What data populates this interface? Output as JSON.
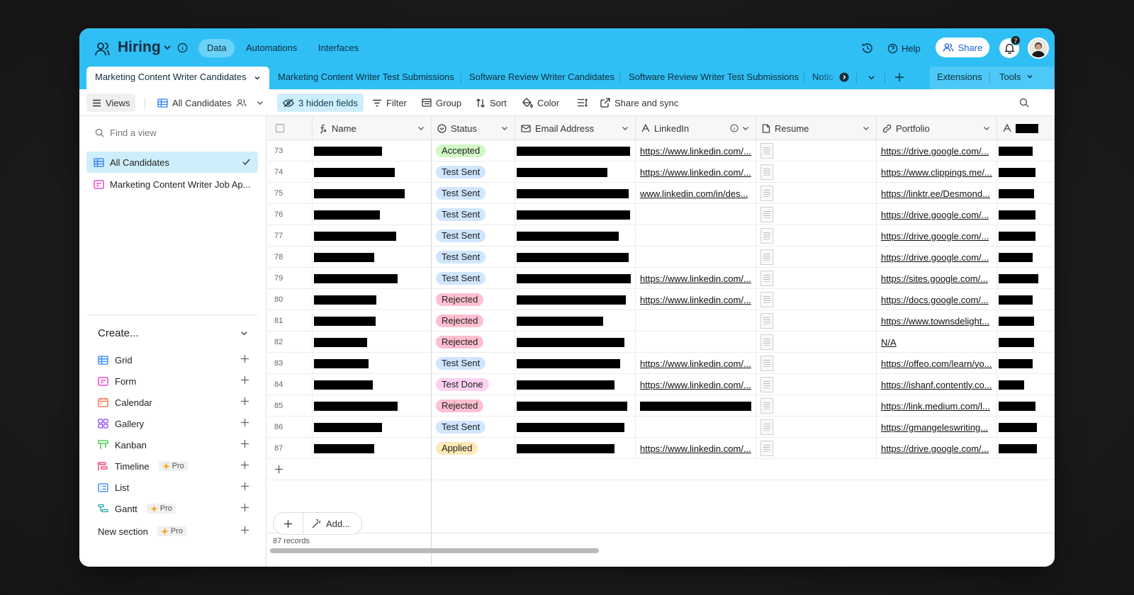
{
  "app": {
    "base_name": "Hiring",
    "nav_tabs": [
      {
        "label": "Data",
        "active": true
      },
      {
        "label": "Automations",
        "active": false
      },
      {
        "label": "Interfaces",
        "active": false
      }
    ],
    "help_label": "Help",
    "share_label": "Share",
    "notification_count": "7"
  },
  "table_tabs": [
    {
      "label": "Marketing Content Writer Candidates",
      "active": true
    },
    {
      "label": "Marketing Content Writer Test Submissions",
      "active": false
    },
    {
      "label": "Software Review Writer Candidates",
      "active": false
    },
    {
      "label": "Software Review Writer Test Submissions",
      "active": false
    },
    {
      "label": "Notic",
      "active": false
    }
  ],
  "extensions_label": "Extensions",
  "tools_label": "Tools",
  "toolbar": {
    "views_label": "Views",
    "current_view": "All Candidates",
    "hidden_fields": "3 hidden fields",
    "filter": "Filter",
    "group": "Group",
    "sort": "Sort",
    "color": "Color",
    "share_sync": "Share and sync"
  },
  "sidebar": {
    "find_placeholder": "Find a view",
    "views": [
      {
        "label": "All Candidates",
        "active": true,
        "icon": "grid-icon"
      },
      {
        "label": "Marketing Content Writer Job Ap...",
        "active": false,
        "icon": "form-icon"
      }
    ],
    "create_label": "Create...",
    "create_items": [
      {
        "label": "Grid",
        "icon": "grid-icon",
        "color": "#2d7ff9",
        "pro": false
      },
      {
        "label": "Form",
        "icon": "form-icon",
        "color": "#e929ba",
        "pro": false
      },
      {
        "label": "Calendar",
        "icon": "calendar-icon",
        "color": "#f7653b",
        "pro": false
      },
      {
        "label": "Gallery",
        "icon": "gallery-icon",
        "color": "#8b46ff",
        "pro": false
      },
      {
        "label": "Kanban",
        "icon": "kanban-icon",
        "color": "#20c933",
        "pro": false
      },
      {
        "label": "Timeline",
        "icon": "timeline-icon",
        "color": "#f82b60",
        "pro": true
      },
      {
        "label": "List",
        "icon": "list-icon",
        "color": "#2d7ff9",
        "pro": false
      },
      {
        "label": "Gantt",
        "icon": "gantt-icon",
        "color": "#20a9a0",
        "pro": true
      }
    ],
    "new_section_label": "New section",
    "pro_label": "Pro"
  },
  "grid": {
    "columns": [
      "Name",
      "Status",
      "Email Address",
      "LinkedIn",
      "Resume",
      "Portfolio"
    ],
    "status_colors": {
      "Accepted": "#d1f7c4",
      "Test Sent": "#d0e6ff",
      "Rejected": "#ffbfd1",
      "Test Done": "#fdd2f1",
      "Applied": "#ffeab6"
    },
    "rows": [
      {
        "num": "73",
        "status": "Accepted",
        "linkedin": "https://www.linkedin.com/...",
        "portfolio": "https://drive.google.com/..."
      },
      {
        "num": "74",
        "status": "Test Sent",
        "linkedin": "https://www.linkedin.com/...",
        "portfolio": "https://www.clippings.me/..."
      },
      {
        "num": "75",
        "status": "Test Sent",
        "linkedin": "www.linkedin.com/in/des...",
        "portfolio": "https://linktr.ee/Desmond..."
      },
      {
        "num": "76",
        "status": "Test Sent",
        "linkedin": "",
        "portfolio": "https://drive.google.com/..."
      },
      {
        "num": "77",
        "status": "Test Sent",
        "linkedin": "",
        "portfolio": "https://drive.google.com/..."
      },
      {
        "num": "78",
        "status": "Test Sent",
        "linkedin": "",
        "portfolio": "https://drive.google.com/..."
      },
      {
        "num": "79",
        "status": "Test Sent",
        "linkedin": "https://www.linkedin.com/...",
        "portfolio": "https://sites.google.com/..."
      },
      {
        "num": "80",
        "status": "Rejected",
        "linkedin": "https://www.linkedin.com/...",
        "portfolio": "https://docs.google.com/..."
      },
      {
        "num": "81",
        "status": "Rejected",
        "linkedin": "",
        "portfolio": "https://www.townsdelight..."
      },
      {
        "num": "82",
        "status": "Rejected",
        "linkedin": "",
        "portfolio": "N/A"
      },
      {
        "num": "83",
        "status": "Test Sent",
        "linkedin": "https://www.linkedin.com/...",
        "portfolio": "https://offeo.com/learn/yo..."
      },
      {
        "num": "84",
        "status": "Test Done",
        "linkedin": "https://www.linkedin.com/...",
        "portfolio": "https://ishanf.contently.co..."
      },
      {
        "num": "85",
        "status": "Rejected",
        "linkedin": "",
        "portfolio": "https://link.medium.com/l..."
      },
      {
        "num": "86",
        "status": "Test Sent",
        "linkedin": "",
        "portfolio": "https://gmangeleswriting..."
      },
      {
        "num": "87",
        "status": "Applied",
        "linkedin": "https://www.linkedin.com/...",
        "portfolio": "https://drive.google.com/..."
      }
    ],
    "add_label": "Add...",
    "records_label": "87 records"
  }
}
